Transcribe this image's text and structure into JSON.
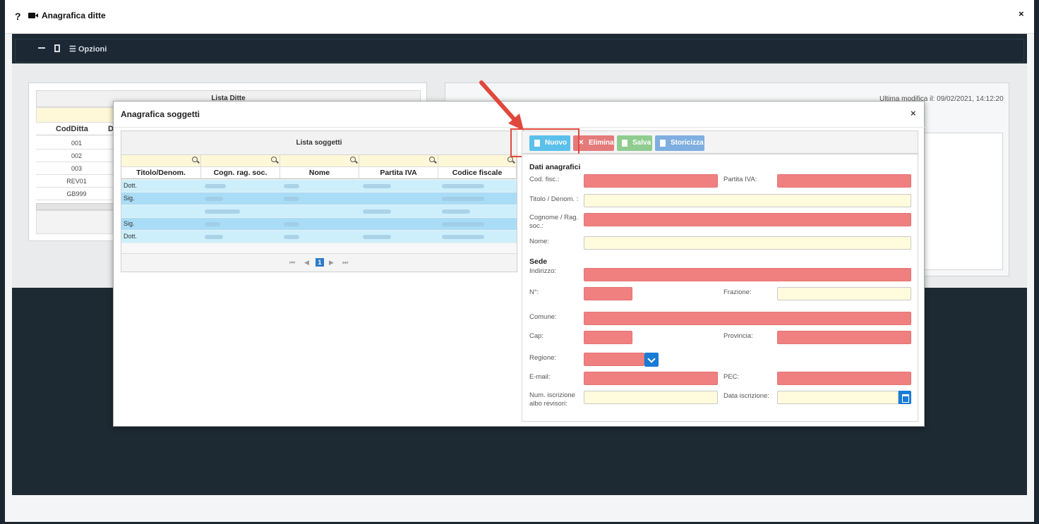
{
  "outer": {
    "question_mark": "?",
    "title": "Anagrafica ditte",
    "close": "×",
    "toolbar_options": "Opzioni"
  },
  "background": {
    "lista_ditte_title": "Lista Ditte",
    "col_coddita": "CodDitta",
    "col_d": "D",
    "rows": [
      "001",
      "002",
      "003",
      "REV01",
      "GB999"
    ],
    "ultima_modifica": "Ultima modifica il: 09/02/2021, 14:12:20"
  },
  "modal": {
    "title": "Anagrafica soggetti",
    "close": "×",
    "grid": {
      "title": "Lista soggetti",
      "columns": [
        "Titolo/Denom.",
        "Cogn. rag. soc.",
        "Nome",
        "Partita IVA",
        "Codice fiscale"
      ],
      "rows": [
        {
          "titolo": "Dott."
        },
        {
          "titolo": "Sig."
        },
        {
          "titolo": ""
        },
        {
          "titolo": "Sig."
        },
        {
          "titolo": "Dott."
        }
      ],
      "pager": {
        "first": "⏮",
        "prev": "◀",
        "current": "1",
        "next": "▶",
        "last": "⏭"
      }
    },
    "buttons": {
      "nuovo": "Nuovo",
      "elimina": "Elimina",
      "salva": "Salva",
      "storicizza": "Storicizza"
    },
    "form": {
      "dati_anagrafici": "Dati anagrafici",
      "cod_fisc": "Cod. fisc.:",
      "partita_iva": "Partita IVA:",
      "titolo_denom": "Titolo / Denom. :",
      "cognome": "Cognome / Rag. soc.:",
      "nome": "Nome:",
      "sede": "Sede",
      "indirizzo": "Indirizzo:",
      "numero": "N°:",
      "frazione": "Frazione:",
      "comune": "Comune:",
      "cap": "Cap:",
      "provincia": "Provincia:",
      "regione": "Regione:",
      "email": "E-mail:",
      "pec": "PEC:",
      "num_iscrizione": "Num. iscrizione albo revisori:",
      "data_iscrizione": "Data iscrizione:"
    }
  },
  "colors": {
    "required_field": "#f08080",
    "optional_field": "#fffbdc",
    "highlight": "#e0483c",
    "primary": "#1a7bd6"
  }
}
